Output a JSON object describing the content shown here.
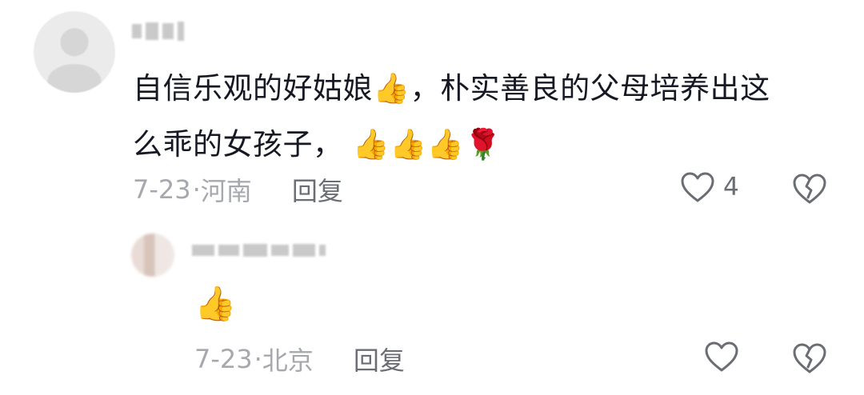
{
  "comment": {
    "text_line1": "自信乐观的好姑娘",
    "text_line1b": "，朴实善良的父母培养出这",
    "text_line2": "么乖的女孩子，",
    "emoji_thumbs": "👍",
    "emoji_rose": "🌹",
    "date": "7-23",
    "separator": "·",
    "location": "河南",
    "reply_label": "回复",
    "like_count": "4"
  },
  "reply": {
    "emoji_thumbs": "👍",
    "date": "7-23",
    "separator": "·",
    "location": "北京",
    "reply_label": "回复"
  },
  "icons": {
    "like": "heart-outline-icon",
    "dislike": "broken-heart-icon"
  },
  "colors": {
    "text": "#161823",
    "meta": "#a7a8ad",
    "action": "#6b6d74"
  }
}
